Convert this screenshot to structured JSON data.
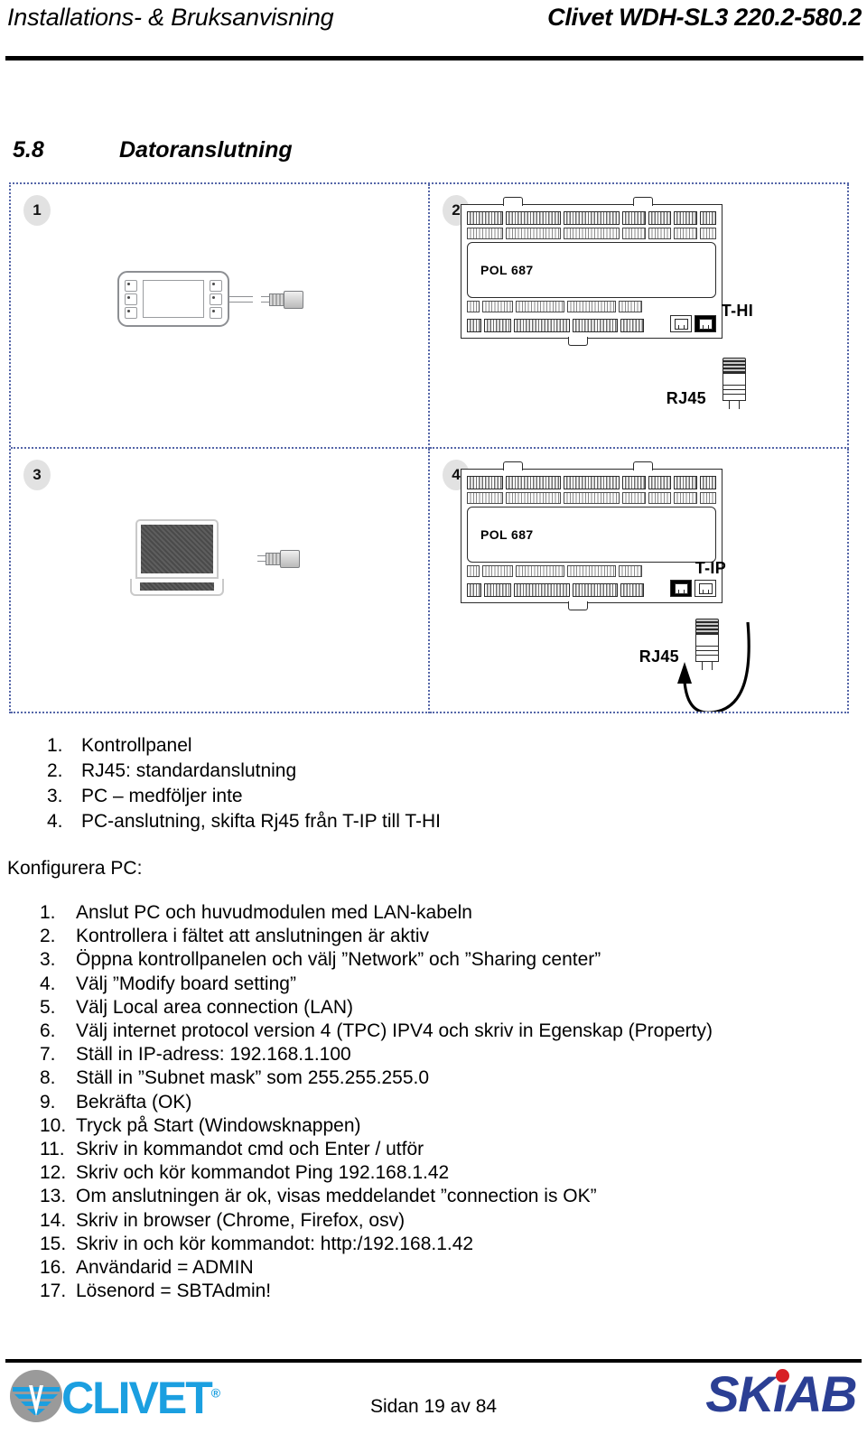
{
  "header": {
    "left_title": "Installations- & Bruksanvisning",
    "right_title": "Clivet WDH-SL3 220.2-580.2"
  },
  "section": {
    "number": "5.8",
    "title": "Datoranslutning"
  },
  "figure": {
    "quadrants": [
      {
        "badge": "1",
        "content": "control-panel-with-rj45-cable"
      },
      {
        "badge": "2",
        "content": "pol-board",
        "board_label": "POL 687",
        "port_label": "T-HI",
        "connector_label": "RJ45"
      },
      {
        "badge": "3",
        "content": "laptop-with-rj45-connector"
      },
      {
        "badge": "4",
        "content": "pol-board",
        "board_label": "POL 687",
        "port_label": "T-IP",
        "connector_label": "RJ45"
      }
    ]
  },
  "legend": {
    "items": [
      {
        "num": "1.",
        "text": "Kontrollpanel"
      },
      {
        "num": "2.",
        "text": "RJ45: standardanslutning"
      },
      {
        "num": "3.",
        "text": "PC – medföljer inte"
      },
      {
        "num": "4.",
        "text": "PC-anslutning, skifta Rj45 från T-IP till T-HI"
      }
    ]
  },
  "config": {
    "heading": "Konfigurera PC:",
    "steps": [
      {
        "num": "1.",
        "text": "Anslut PC och huvudmodulen med LAN-kabeln"
      },
      {
        "num": "2.",
        "text": "Kontrollera i fältet att anslutningen är aktiv"
      },
      {
        "num": "3.",
        "text": "Öppna kontrollpanelen och välj ”Network” och ”Sharing center”"
      },
      {
        "num": "4.",
        "text": "Välj ”Modify board setting”"
      },
      {
        "num": "5.",
        "text": "Välj Local area connection (LAN)"
      },
      {
        "num": "6.",
        "text": "Välj internet protocol version 4 (TPC) IPV4 och skriv in Egenskap (Property)"
      },
      {
        "num": "7.",
        "text": "Ställ in IP-adress: 192.168.1.100"
      },
      {
        "num": "8.",
        "text": "Ställ in ”Subnet mask” som 255.255.255.0"
      },
      {
        "num": "9.",
        "text": "Bekräfta (OK)"
      },
      {
        "num": "10.",
        "text": "Tryck på Start (Windowsknappen)"
      },
      {
        "num": "11.",
        "text": "Skriv in kommandot cmd och Enter / utför"
      },
      {
        "num": "12.",
        "text": "Skriv och kör kommandot Ping 192.168.1.42"
      },
      {
        "num": "13.",
        "text": "Om anslutningen är ok, visas meddelandet ”connection is OK”"
      },
      {
        "num": "14.",
        "text": "Skriv in browser (Chrome, Firefox, osv)"
      },
      {
        "num": "15.",
        "text": "Skriv in och kör kommandot: http:/192.168.1.42"
      },
      {
        "num": "16.",
        "text": "Användarid = ADMIN"
      },
      {
        "num": "17.",
        "text": "Lösenord = SBTAdmin!"
      }
    ]
  },
  "footer": {
    "clivet_wordmark": "CLIVET",
    "clivet_registered": "®",
    "skiab_wordmark": "SKiAB",
    "page_number": "Sidan 19 av 84"
  },
  "colors": {
    "clivet_blue": "#1b9fe0",
    "clivet_gray": "#9a9a9a",
    "skiab_blue": "#2b3f94",
    "skiab_red": "#d81f26",
    "grid_dot": "#5566a8"
  }
}
